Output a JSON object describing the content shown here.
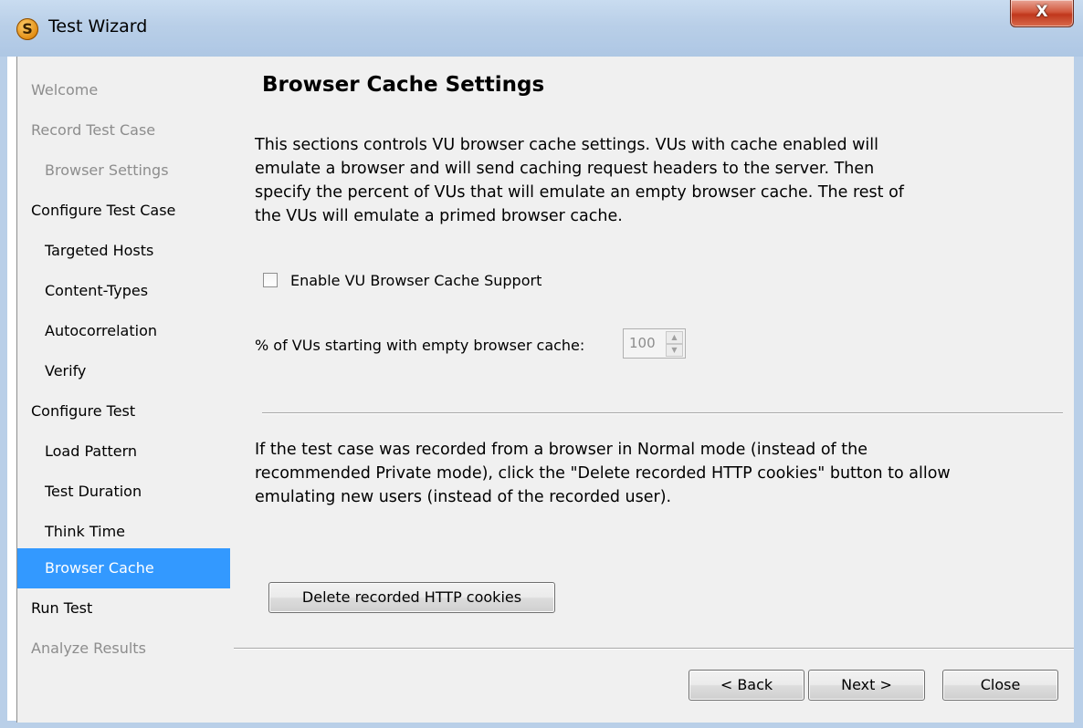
{
  "window": {
    "title": "Test Wizard",
    "app_icon_letter": "S",
    "close_glyph": "X"
  },
  "nav": {
    "items": [
      {
        "label": "Welcome",
        "level": 1,
        "state": "disabled"
      },
      {
        "label": "Record Test Case",
        "level": 1,
        "state": "disabled"
      },
      {
        "label": "Browser Settings",
        "level": 2,
        "state": "disabled"
      },
      {
        "label": "Configure Test Case",
        "level": 1,
        "state": "enabled"
      },
      {
        "label": "Targeted Hosts",
        "level": 2,
        "state": "enabled"
      },
      {
        "label": "Content-Types",
        "level": 2,
        "state": "enabled"
      },
      {
        "label": "Autocorrelation",
        "level": 2,
        "state": "enabled"
      },
      {
        "label": "Verify",
        "level": 2,
        "state": "enabled"
      },
      {
        "label": "Configure Test",
        "level": 1,
        "state": "enabled"
      },
      {
        "label": "Load Pattern",
        "level": 2,
        "state": "enabled"
      },
      {
        "label": "Test Duration",
        "level": 2,
        "state": "enabled"
      },
      {
        "label": "Think Time",
        "level": 2,
        "state": "enabled"
      },
      {
        "label": "Browser Cache",
        "level": 2,
        "state": "selected"
      },
      {
        "label": "Run Test",
        "level": 1,
        "state": "enabled"
      },
      {
        "label": "Analyze Results",
        "level": 1,
        "state": "disabled"
      }
    ]
  },
  "content": {
    "title": "Browser Cache Settings",
    "description": "This sections controls VU browser cache settings. VUs with cache enabled will\nemulate a browser and will send caching request headers to the server. Then\nspecify the percent of VUs that will emulate an empty browser cache. The rest of\nthe VUs will emulate a primed browser cache.",
    "enable_cache_label": "Enable VU Browser Cache Support",
    "enable_cache_checked": false,
    "empty_cache_label": "% of VUs starting with empty browser cache:",
    "empty_cache_value": "100",
    "cookies_description": "If the test case was recorded from a browser in Normal mode (instead of the\nrecommended Private mode), click the \"Delete recorded HTTP cookies\" button to allow\nemulating new users (instead of the recorded user).",
    "delete_cookies_label": "Delete recorded HTTP cookies"
  },
  "footer": {
    "back_label": "< Back",
    "next_label": "Next >",
    "close_label": "Close"
  },
  "colors": {
    "selection": "#3399ff",
    "disabled_text": "#8d8d8d",
    "panel_bg": "#f0f0f0",
    "titlebar": "#b9cfe8",
    "close_button": "#c7472c"
  }
}
